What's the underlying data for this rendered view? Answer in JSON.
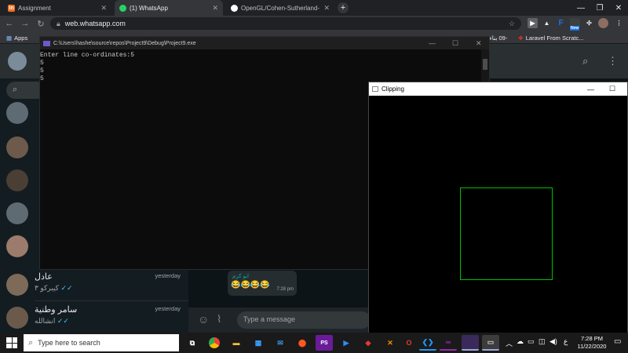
{
  "browser": {
    "tabs": [
      {
        "label": "Assignment",
        "icon": "in"
      },
      {
        "label": "(1) WhatsApp"
      },
      {
        "label": "OpenGL/Cohen-Sutherland-Line"
      }
    ],
    "new_tab_glyph": "+",
    "window_controls": {
      "minimize": "—",
      "restore": "❐",
      "close": "✕"
    },
    "url": "web.whatsapp.com",
    "ext_f": "F",
    "ext_badge": "New",
    "bookmarks": {
      "apps": "Apps",
      "rtl_fragment": "-09 بناء ش",
      "laravel": "Laravel From Scratc..."
    }
  },
  "whatsapp": {
    "chats": [
      {
        "name": "عادل",
        "message": "كيبركو ٣",
        "date": "yesterday"
      },
      {
        "name": "سامر وطنية",
        "message": "انشالله",
        "date": "yesterday"
      }
    ],
    "bubble": {
      "sender": "ابو كرم",
      "emojis": "😂😂😂😂",
      "time": "7:28 pm"
    },
    "composer_placeholder": "Type a message"
  },
  "console": {
    "title": "C:\\Users\\hashe\\source\\repos\\Project9\\Debug\\Project9.exe",
    "lines": [
      "Enter line co-ordinates:5",
      "5",
      "5",
      "5"
    ]
  },
  "clipping_window": {
    "title": "Clipping"
  },
  "taskbar": {
    "search_placeholder": "Type here to search",
    "time": "7:28 PM",
    "date": "11/22/2020",
    "lang": "ع"
  },
  "colors": {
    "clip_rect": "#00c000",
    "wa_green": "#00af9c"
  }
}
